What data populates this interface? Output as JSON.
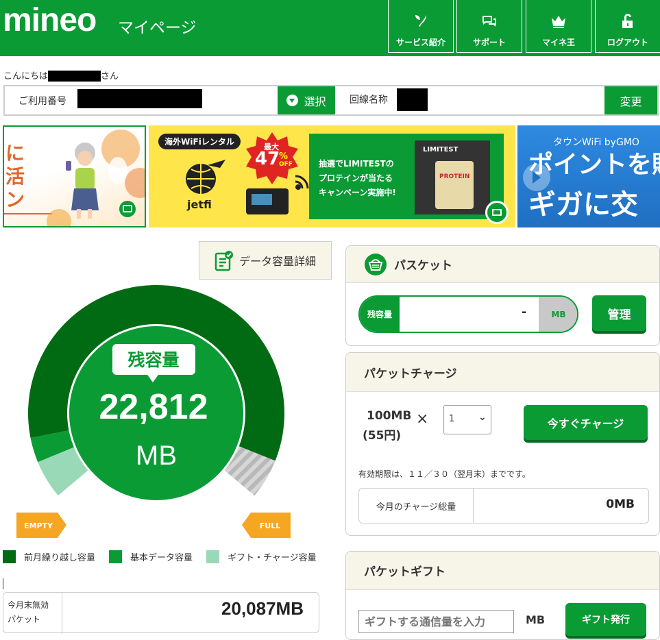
{
  "header": {
    "logo": "mineo",
    "subtitle": "マイページ",
    "nav": [
      {
        "label": "サービス紹介",
        "icon": "heart-leaf-icon"
      },
      {
        "label": "サポート",
        "icon": "chat-bubbles-icon"
      },
      {
        "label": "マイネ王",
        "icon": "crown-icon"
      },
      {
        "label": "ログアウト",
        "icon": "unlock-icon"
      }
    ]
  },
  "greeting": {
    "prefix": "こんにちは",
    "suffix": "さん"
  },
  "line_select": {
    "number_label": "ご利用番号",
    "select_label": "選択",
    "line_name_label": "回線名称",
    "change_label": "変更"
  },
  "banners": {
    "left": {
      "text": "に\n活\nン"
    },
    "center": {
      "tag": "海外WiFiレンタル",
      "discount_top": "最大",
      "discount_value": "47",
      "discount_unit": "%",
      "discount_off": "OFF",
      "brand": "jetfi",
      "campaign_lines": [
        "抽選でLIMITESTの",
        "プロテインが当たる",
        "キャンペーン実施中!"
      ],
      "product_brand": "LIMITEST",
      "product_label": "PROTEIN"
    },
    "right": {
      "top": "タウンWiFi byGMO",
      "line1": "ポイントを貯",
      "line2": "ギガに交"
    }
  },
  "data_capacity": {
    "detail_button": "データ容量詳細",
    "remaining_label": "残容量",
    "remaining_value": "22,812",
    "unit": "MB",
    "empty_label": "EMPTY",
    "full_label": "FULL",
    "gauge": {
      "carryover": 20087,
      "basic": 1070,
      "gift_charge": 1655,
      "colors": {
        "carryover": "#006b12",
        "basic": "#0a9b35",
        "gift_charge": "#99d9b8",
        "empty": "#cccccc"
      }
    },
    "legend": [
      {
        "label": "前月繰り越し容量",
        "color": "#006b12"
      },
      {
        "label": "基本データ容量",
        "color": "#0a9b35"
      },
      {
        "label": "ギフト・チャージ容量",
        "color": "#99d9b8"
      }
    ],
    "expire": {
      "label_line1": "今月末無効",
      "label_line2": "パケット",
      "value": "20,087MB"
    }
  },
  "packet": {
    "title": "パスケット",
    "remaining_label": "残容量",
    "value": "-",
    "unit": "MB",
    "manage_button": "管理"
  },
  "charge": {
    "title": "パケットチャージ",
    "amount": "100MB",
    "price": "(55円)",
    "times": "×",
    "qty_value": "1",
    "button": "今すぐチャージ",
    "note": "有効期限は、１１／３０（翌月末）までです。",
    "total_label": "今月のチャージ総量",
    "total_value": "0MB"
  },
  "gift": {
    "title": "パケットギフト",
    "input_placeholder": "ギフトする通信量を入力",
    "unit": "MB",
    "button": "ギフト発行"
  }
}
